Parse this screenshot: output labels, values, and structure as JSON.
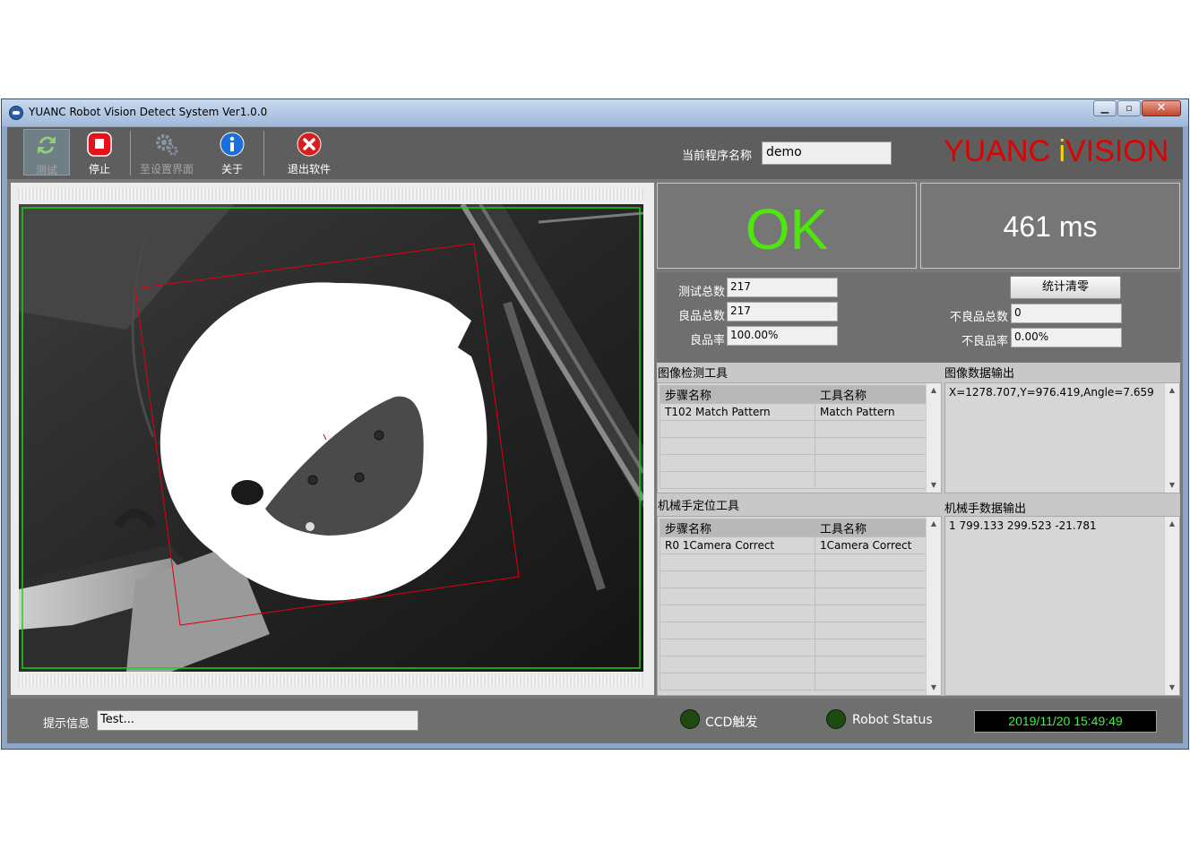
{
  "window": {
    "title": "YUANC Robot Vision Detect System  Ver1.0.0"
  },
  "toolbar": {
    "test_label": "测试",
    "stop_label": "停止",
    "settings_label": "至设置界面",
    "about_label": "关于",
    "exit_label": "退出软件"
  },
  "program": {
    "label": "当前程序名称",
    "value": "demo"
  },
  "brand": {
    "part1": "YUANC ",
    "part2": "i",
    "part3": "VISION"
  },
  "result": {
    "status": "OK",
    "time": "461 ms",
    "ok_color": "#4fe60e"
  },
  "stats": {
    "total_label": "测试总数",
    "total": "217",
    "good_label": "良品总数",
    "good": "217",
    "good_rate_label": "良品率",
    "good_rate": "100.00%",
    "reset_label": "统计清零",
    "bad_label": "不良品总数",
    "bad": "0",
    "bad_rate_label": "不良品率",
    "bad_rate": "0.00%"
  },
  "vision_tools": {
    "title": "图像检测工具",
    "headers": [
      "步骤名称",
      "工具名称"
    ],
    "rows": [
      [
        "T102 Match Pattern",
        "Match Pattern"
      ]
    ]
  },
  "image_output": {
    "title": "图像数据输出",
    "text": "X=1278.707,Y=976.419,Angle=7.659"
  },
  "robot_tools": {
    "title": "机械手定位工具",
    "headers": [
      "步骤名称",
      "工具名称"
    ],
    "rows": [
      [
        "R0 1Camera Correct",
        "1Camera Correct"
      ]
    ]
  },
  "robot_output": {
    "title": "机械手数据输出",
    "text": "1 799.133 299.523 -21.781"
  },
  "statusbar": {
    "hint_label": "提示信息",
    "hint_value": "Test...",
    "ccd_label": "CCD触发",
    "robot_label": "Robot Status",
    "datetime": "2019/11/20  15:49:49"
  }
}
